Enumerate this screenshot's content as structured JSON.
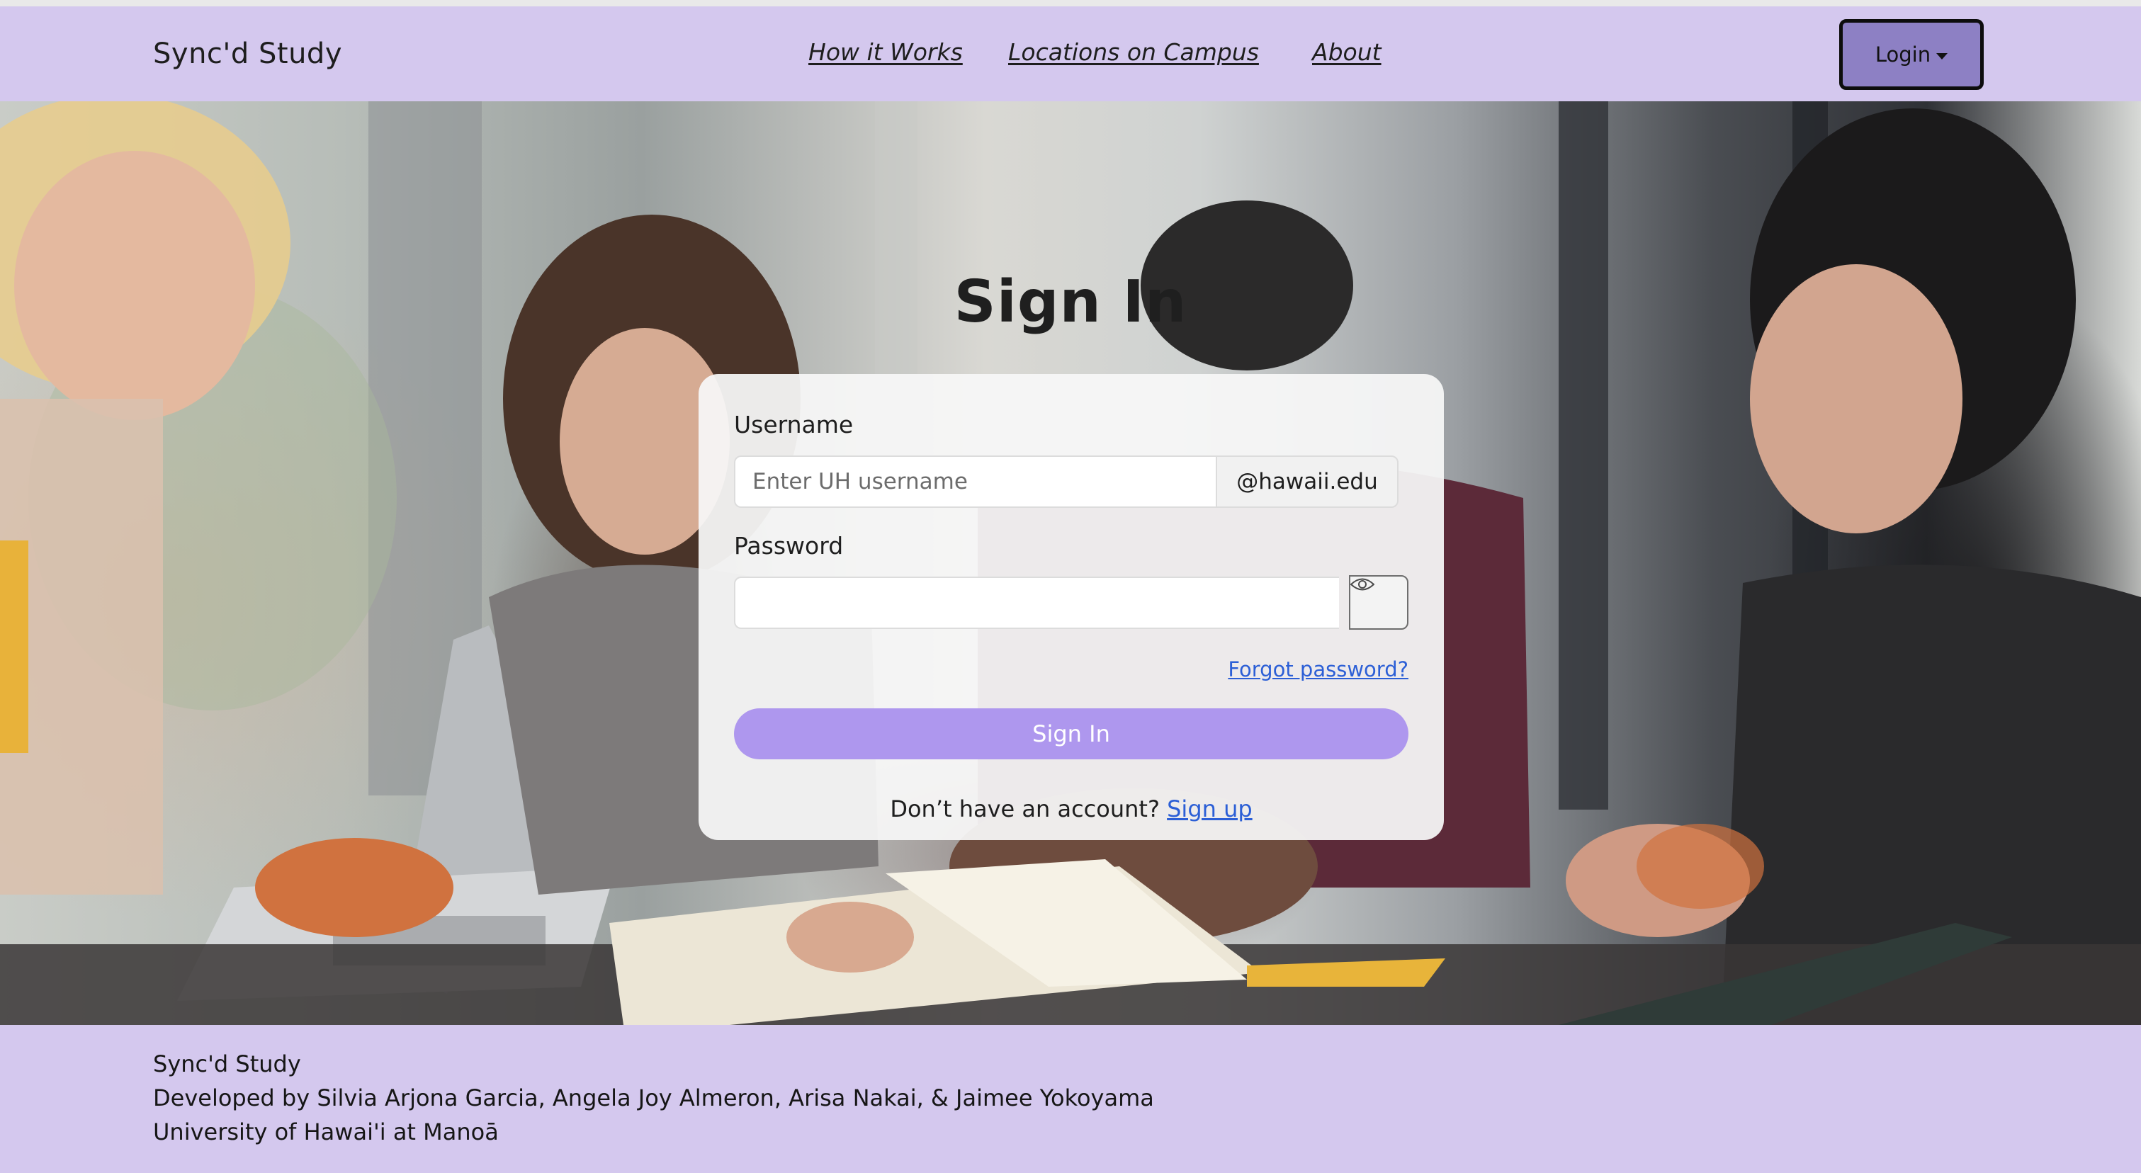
{
  "navbar": {
    "brand": "Sync'd Study",
    "links": [
      "How it Works",
      "Locations on Campus",
      "About"
    ],
    "login_label": "Login"
  },
  "signin": {
    "title": "Sign In",
    "username_label": "Username",
    "username_placeholder": "Enter UH username",
    "username_value": "",
    "domain_suffix": "@hawaii.edu",
    "password_label": "Password",
    "password_value": "",
    "forgot_label": "Forgot password?",
    "submit_label": "Sign In",
    "no_account_text": "Don’t have an account?",
    "signup_label": "Sign up"
  },
  "footer": {
    "line1": "Sync'd Study",
    "line2": "Developed by Silvia Arjona Garcia, Angela Joy Almeron, Arisa Nakai, & Jaimee Yokoyama",
    "line3": "University of Hawai'i at Manoā"
  },
  "colors": {
    "nav_bg": "#d4c8ee",
    "login_bg": "#8d80c4",
    "accent_button": "#ae97ee",
    "link": "#2c5fd6"
  },
  "icons": {
    "password_toggle": "eye-icon",
    "login_dropdown": "caret-down-icon"
  }
}
